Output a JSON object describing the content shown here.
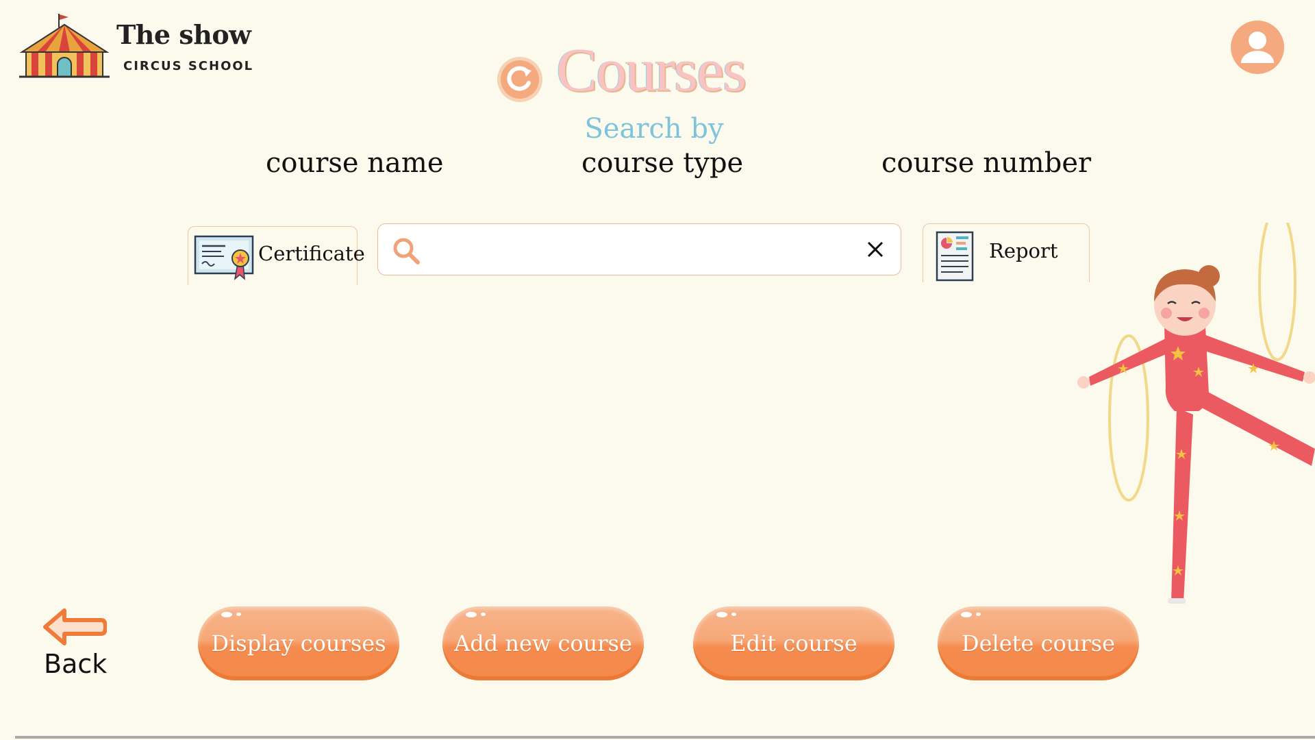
{
  "logo": {
    "name": "The show",
    "tagline": "CIRCUS SCHOOL"
  },
  "page": {
    "title": "Courses"
  },
  "search": {
    "heading": "Search by",
    "options": [
      "course name",
      "course type",
      "course number"
    ],
    "value": "",
    "placeholder": ""
  },
  "tabs": {
    "certificate": "Certificate",
    "report": "Report"
  },
  "actions": {
    "display": "Display courses",
    "add": "Add new course",
    "edit": "Edit course",
    "delete": "Delete course",
    "back": "Back"
  },
  "icons": [
    "circus-tent-icon",
    "refresh-icon",
    "search-icon",
    "close-icon",
    "certificate-icon",
    "report-icon",
    "user-icon",
    "back-arrow-icon"
  ],
  "colors": {
    "background": "#fbfaec",
    "accent": "#f4a97e",
    "button": "#f58b4e",
    "search_by": "#7ec3dc",
    "title": "#f9c3c3"
  }
}
